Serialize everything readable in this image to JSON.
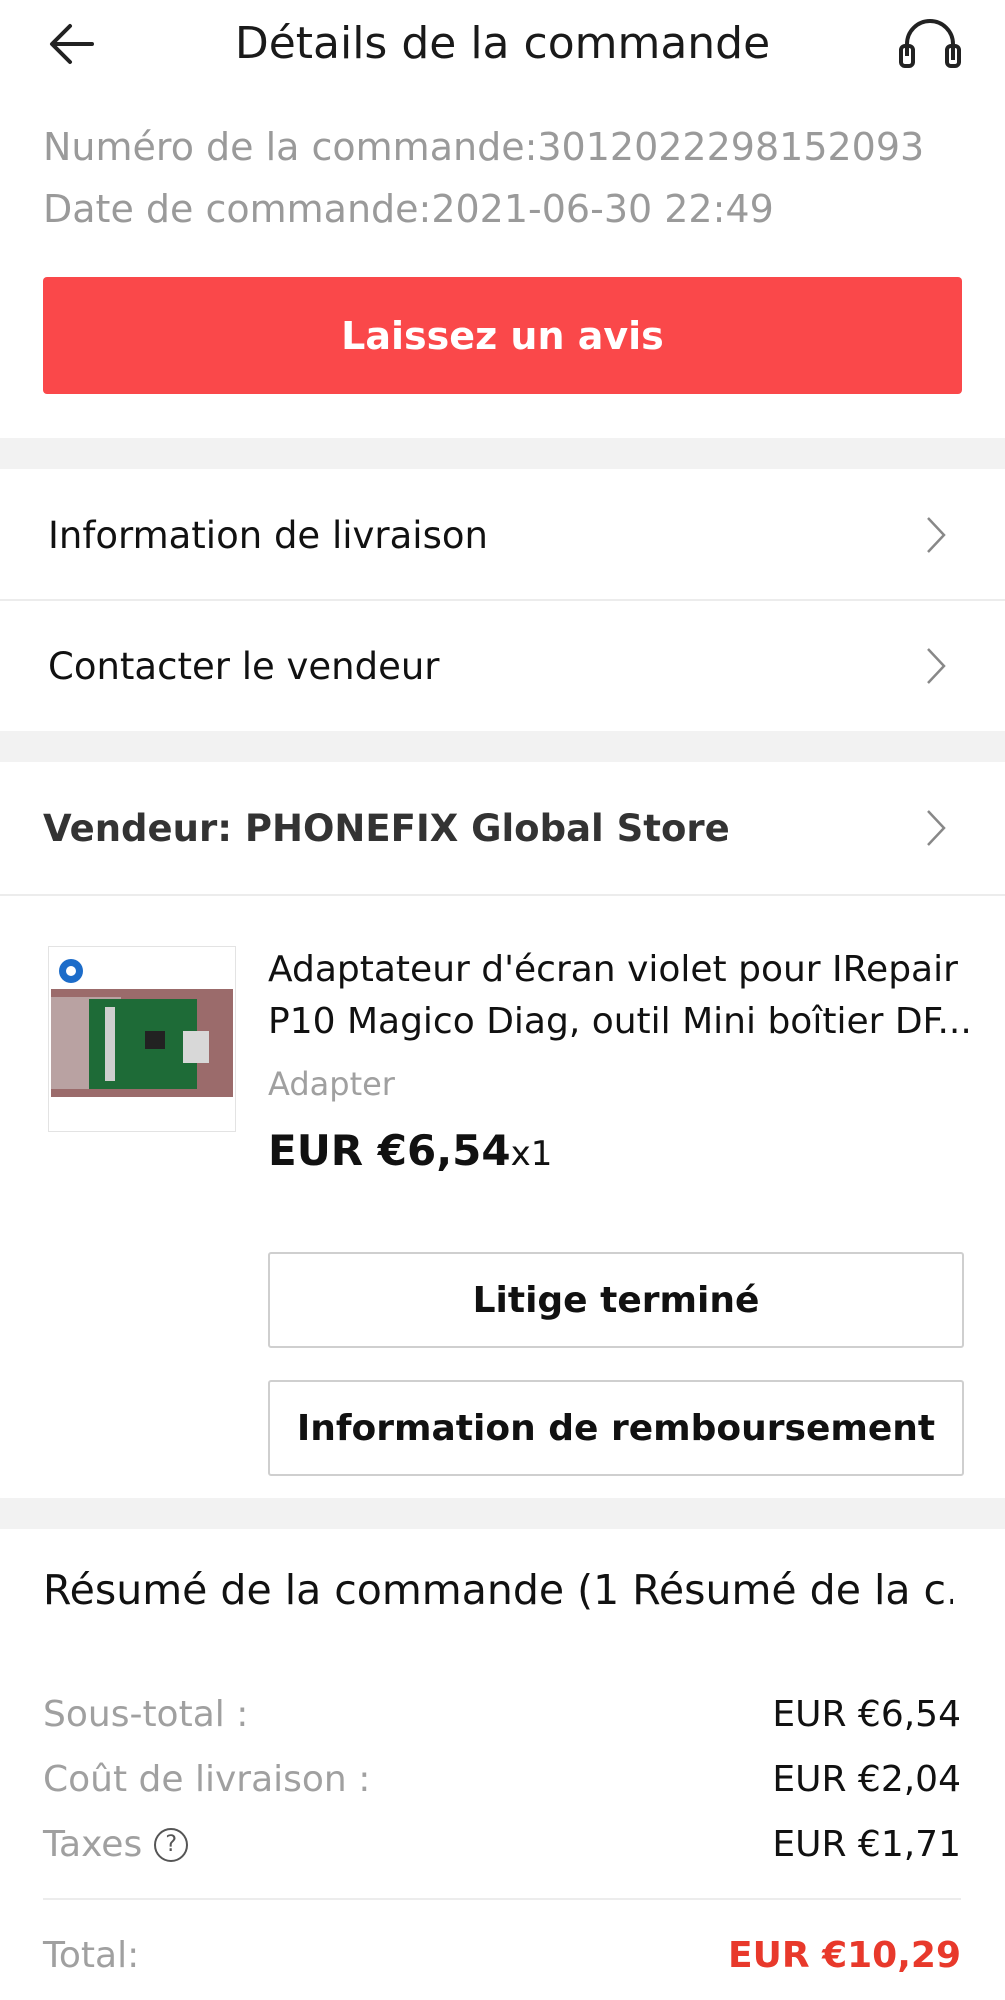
{
  "header": {
    "title": "Détails de la commande"
  },
  "order": {
    "number_label": "Numéro de la commande:3012022298152093",
    "date_label": "Date de commande:2021-06-30 22:49"
  },
  "review_button": "Laissez un avis",
  "menu": {
    "shipping": "Information de livraison",
    "contact": "Contacter le vendeur"
  },
  "seller": {
    "label": "Vendeur: PHONEFIX Global Store"
  },
  "product": {
    "title_line1": "Adaptateur d'écran violet pour IRepair",
    "title_line2": "P10 Magico Diag, outil Mini boîtier DF...",
    "variant": "Adapter",
    "price": "EUR €6,54",
    "quantity": "x1"
  },
  "actions": {
    "dispute": "Litige terminé",
    "refund": "Information de remboursement"
  },
  "summary": {
    "title": "Résumé de la commande (1 Résumé de la c...",
    "subtotal_label": "Sous-total :",
    "subtotal": "EUR €6,54",
    "shipping_label": "Coût de livraison :",
    "shipping": "EUR €2,04",
    "tax_label": "Taxes",
    "tax": "EUR €1,71",
    "total_label": "Total:",
    "total": "EUR €10,29"
  },
  "colors": {
    "accent": "#fa484a",
    "total": "#e8392b",
    "muted": "#9a9a9a"
  }
}
